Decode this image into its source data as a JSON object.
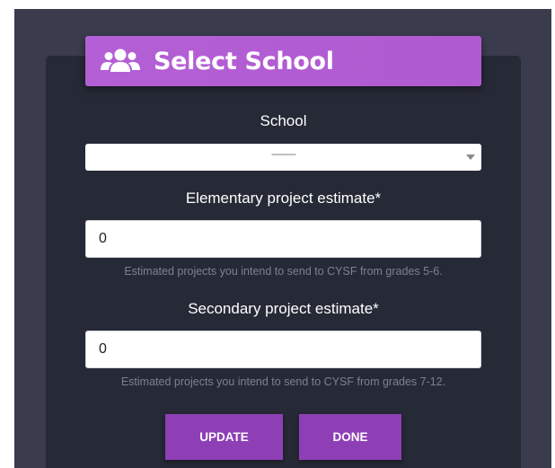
{
  "header": {
    "title": "Select School",
    "icon": "users-icon"
  },
  "school": {
    "label": "School",
    "selected": "---------"
  },
  "elementary": {
    "label": "Elementary project estimate*",
    "value": "0",
    "help": "Estimated projects you intend to send to CYSF from grades 5-6."
  },
  "secondary": {
    "label": "Secondary project estimate*",
    "value": "0",
    "help": "Estimated projects you intend to send to CYSF from grades 7-12."
  },
  "buttons": {
    "update": "UPDATE",
    "done": "DONE"
  },
  "colors": {
    "accent": "#b55fd6",
    "button": "#8e3fb6",
    "panel": "#262936",
    "backdrop": "#3a3c4d"
  }
}
